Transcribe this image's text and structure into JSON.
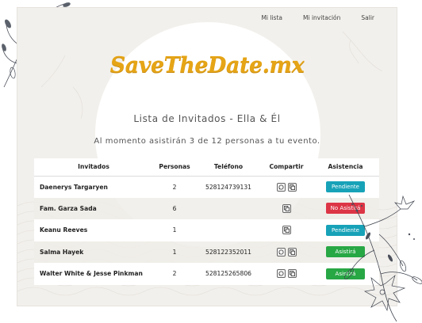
{
  "nav": {
    "items": [
      "Mi lista",
      "Mi invitación",
      "Salir"
    ]
  },
  "logo": "SaveTheDate.mx",
  "title": "Lista de Invitados - Ella & Él",
  "subtitle": "Al momento asistirán 3 de 12 personas a tu evento.",
  "table": {
    "headers": [
      "Invitados",
      "Personas",
      "Teléfono",
      "Compartir",
      "Asistencia"
    ],
    "rows": [
      {
        "name": "Daenerys Targaryen",
        "personas": "2",
        "telefono": "528124739131",
        "whatsapp": true,
        "status": "Pendiente",
        "status_kind": "pending"
      },
      {
        "name": "Fam. Garza Sada",
        "personas": "6",
        "telefono": "",
        "whatsapp": false,
        "status": "No Asistirá",
        "status_kind": "declined"
      },
      {
        "name": "Keanu Reeves",
        "personas": "1",
        "telefono": "",
        "whatsapp": false,
        "status": "Pendiente",
        "status_kind": "pending"
      },
      {
        "name": "Salma Hayek",
        "personas": "1",
        "telefono": "528122352011",
        "whatsapp": true,
        "status": "Asistirá",
        "status_kind": "attending"
      },
      {
        "name": "Walter White & Jesse Pinkman",
        "personas": "2",
        "telefono": "528125265806",
        "whatsapp": true,
        "status": "Asistirá",
        "status_kind": "attending"
      }
    ]
  },
  "colors": {
    "pending": "#17a2b8",
    "declined": "#dc3545",
    "attending": "#28a745",
    "logo": "#e6a516"
  },
  "icons": {
    "whatsapp": "whatsapp-icon",
    "copy": "copy-icon"
  }
}
